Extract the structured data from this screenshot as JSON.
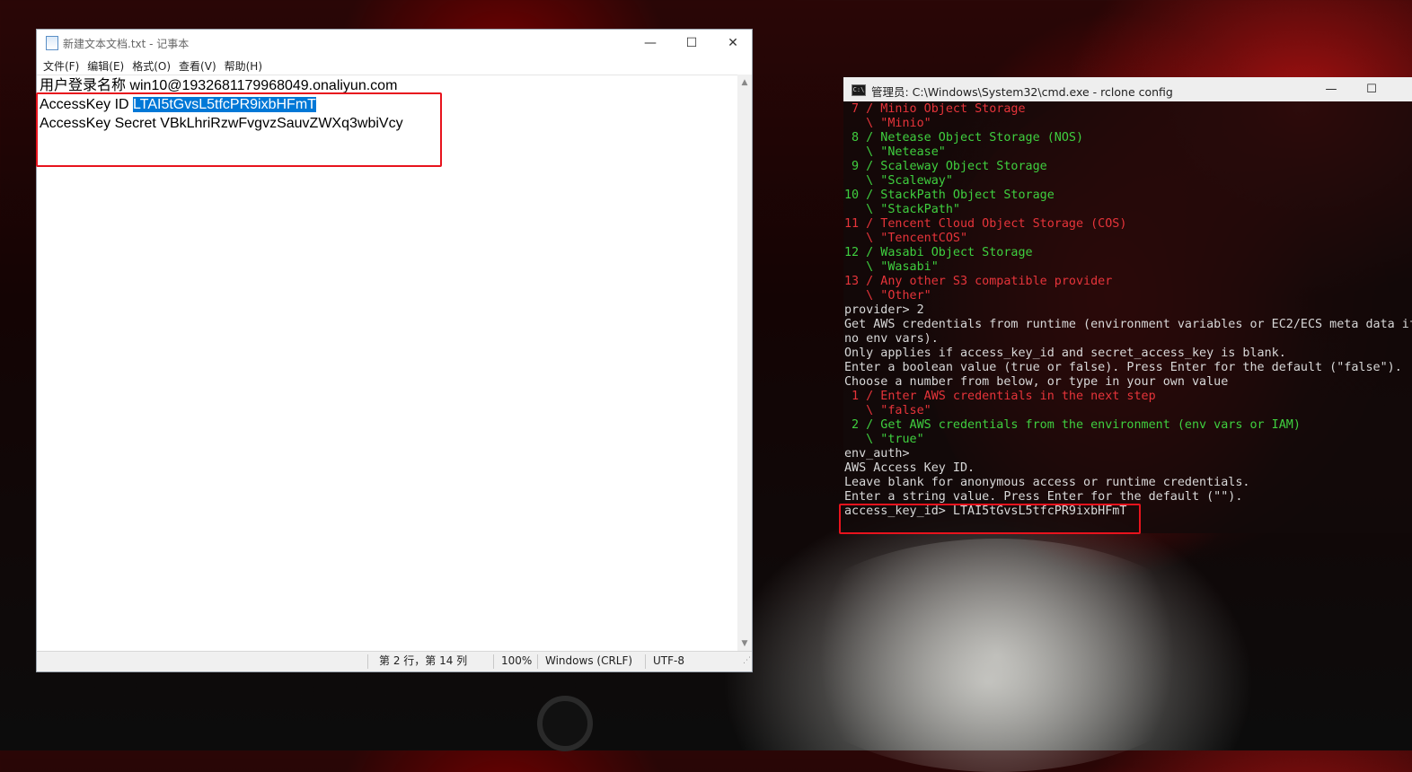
{
  "notepad": {
    "title": "新建文本文档.txt - 记事本",
    "controls": {
      "minimize": "—",
      "maximize": "☐",
      "close": "✕"
    },
    "menu": [
      "文件(F)",
      "编辑(E)",
      "格式(O)",
      "查看(V)",
      "帮助(H)"
    ],
    "lines": {
      "line1": "用户登录名称 win10@1932681179968049.onaliyun.com",
      "line2_prefix": "AccessKey ID ",
      "line2_selected": "LTAI5tGvsL5tfcPR9ixbHFmT",
      "line3": "AccessKey Secret VBkLhriRzwFvgvzSauvZWXq3wbiVcy"
    },
    "status": {
      "position": "第 2 行，第 14 列",
      "zoom": "100%",
      "line_ending": "Windows (CRLF)",
      "encoding": "UTF-8"
    }
  },
  "cmd": {
    "title": "管理员: C:\\Windows\\System32\\cmd.exe - rclone  config",
    "controls": {
      "minimize": "—",
      "maximize": "☐"
    },
    "lines": [
      {
        "text": " 7 / Minio Object Storage",
        "color": "red"
      },
      {
        "text": "   \\ \"Minio\"",
        "color": "red"
      },
      {
        "text": " 8 / Netease Object Storage (NOS)",
        "color": "green"
      },
      {
        "text": "   \\ \"Netease\"",
        "color": "green"
      },
      {
        "text": " 9 / Scaleway Object Storage",
        "color": "green"
      },
      {
        "text": "   \\ \"Scaleway\"",
        "color": "green"
      },
      {
        "text": "10 / StackPath Object Storage",
        "color": "green"
      },
      {
        "text": "   \\ \"StackPath\"",
        "color": "green"
      },
      {
        "text": "11 / Tencent Cloud Object Storage (COS)",
        "color": "red"
      },
      {
        "text": "   \\ \"TencentCOS\"",
        "color": "red"
      },
      {
        "text": "12 / Wasabi Object Storage",
        "color": "green"
      },
      {
        "text": "   \\ \"Wasabi\"",
        "color": "green"
      },
      {
        "text": "13 / Any other S3 compatible provider",
        "color": "red"
      },
      {
        "text": "   \\ \"Other\"",
        "color": "red"
      },
      {
        "text": "provider> 2",
        "color": "white"
      },
      {
        "text": "Get AWS credentials from runtime (environment variables or EC2/ECS meta data if",
        "color": "white"
      },
      {
        "text": "no env vars).",
        "color": "white"
      },
      {
        "text": "Only applies if access_key_id and secret_access_key is blank.",
        "color": "white"
      },
      {
        "text": "Enter a boolean value (true or false). Press Enter for the default (\"false\").",
        "color": "white"
      },
      {
        "text": "Choose a number from below, or type in your own value",
        "color": "white"
      },
      {
        "text": " 1 / Enter AWS credentials in the next step",
        "color": "red"
      },
      {
        "text": "   \\ \"false\"",
        "color": "red"
      },
      {
        "text": " 2 / Get AWS credentials from the environment (env vars or IAM)",
        "color": "green"
      },
      {
        "text": "   \\ \"true\"",
        "color": "green"
      },
      {
        "text": "env_auth>",
        "color": "white"
      },
      {
        "text": "AWS Access Key ID.",
        "color": "white"
      },
      {
        "text": "Leave blank for anonymous access or runtime credentials.",
        "color": "white"
      },
      {
        "text": "Enter a string value. Press Enter for the default (\"\").",
        "color": "white"
      },
      {
        "text": "access_key_id> LTAI5tGvsL5tfcPR9ixbHFmT",
        "color": "white"
      }
    ]
  },
  "colors": {
    "highlight_red": "#e8131d",
    "selection_blue": "#0078d7",
    "cmd_red": "#e6343a",
    "cmd_green": "#3fcf3f",
    "cmd_white": "#d8d8d8"
  }
}
